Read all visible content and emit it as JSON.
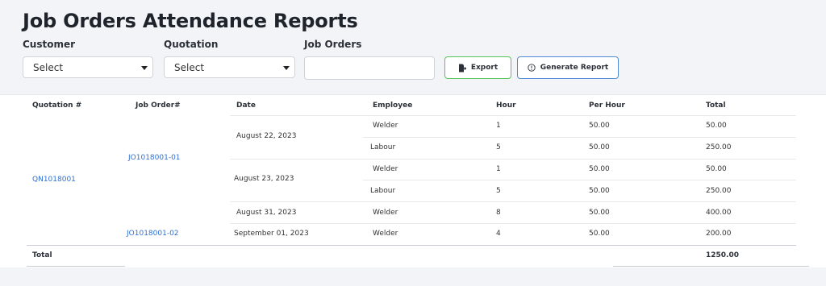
{
  "page": {
    "title": "Job Orders Attendance Reports"
  },
  "filters": {
    "customer": {
      "label": "Customer",
      "value": "Select"
    },
    "quotation": {
      "label": "Quotation",
      "value": "Select"
    },
    "job_orders": {
      "label": "Job Orders",
      "value": ""
    }
  },
  "buttons": {
    "export": "Export",
    "generate": "Generate Report"
  },
  "table": {
    "headers": {
      "quotation": "Quotation #",
      "job_order": "Job Order#",
      "date": "Date",
      "employee": "Employee",
      "hour": "Hour",
      "per_hour": "Per Hour",
      "total": "Total"
    },
    "quotation": "QN1018001",
    "job_orders": [
      "JO1018001-01",
      "JO1018001-02"
    ],
    "dates": [
      "August 22, 2023",
      "August 23, 2023",
      "August 31, 2023",
      "September 01, 2023"
    ],
    "rows": [
      {
        "employee": "Welder",
        "hour": "1",
        "per_hour": "50.00",
        "total": "50.00"
      },
      {
        "employee": "Labour",
        "hour": "5",
        "per_hour": "50.00",
        "total": "250.00"
      },
      {
        "employee": "Welder",
        "hour": "1",
        "per_hour": "50.00",
        "total": "50.00"
      },
      {
        "employee": "Labour",
        "hour": "5",
        "per_hour": "50.00",
        "total": "250.00"
      },
      {
        "employee": "Welder",
        "hour": "8",
        "per_hour": "50.00",
        "total": "400.00"
      },
      {
        "employee": "Welder",
        "hour": "4",
        "per_hour": "50.00",
        "total": "200.00"
      }
    ],
    "footer": {
      "label": "Total",
      "grand_total": "1250.00"
    }
  },
  "colors": {
    "link": "#2f6fd0",
    "export_border": "#56c456",
    "generate_border": "#4f8bd6"
  }
}
